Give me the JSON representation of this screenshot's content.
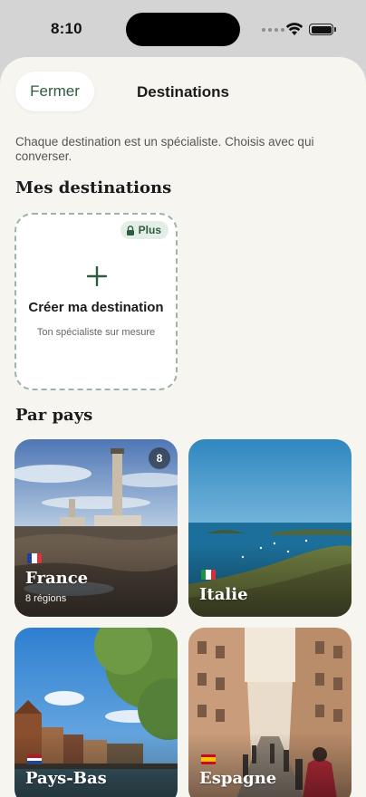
{
  "status_bar": {
    "time": "8:10"
  },
  "header": {
    "close_label": "Fermer",
    "title": "Destinations"
  },
  "intro_text": "Chaque destination est un spécialiste. Choisis avec qui converser.",
  "sections": {
    "mine": "Mes destinations",
    "by_country": "Par pays"
  },
  "create_card": {
    "badge": "Plus",
    "title": "Créer ma destination",
    "subtitle": "Ton spécialiste sur mesure"
  },
  "countries": [
    {
      "name": "France",
      "regions": "8 régions",
      "count": "8",
      "flag": [
        "#1f3f99",
        "#ffffff",
        "#e0323c"
      ]
    },
    {
      "name": "Italie",
      "flag": [
        "#199447",
        "#ffffff",
        "#d8303a"
      ]
    },
    {
      "name": "Pays-Bas",
      "flag": [
        "#ae1c28",
        "#ffffff",
        "#21468b"
      ]
    },
    {
      "name": "Espagne",
      "flag": [
        "#c60b1e",
        "#ffc400",
        "#c60b1e"
      ]
    }
  ],
  "colors": {
    "accent": "#2f5b3f",
    "sheet_bg": "#f7f5f0"
  }
}
